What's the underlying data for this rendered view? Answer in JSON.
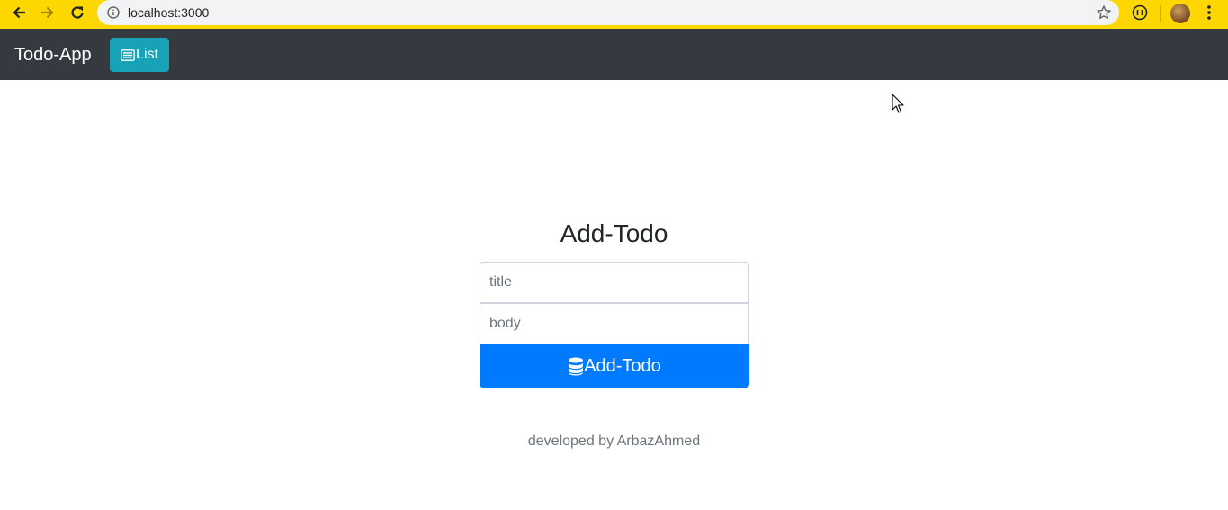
{
  "browser": {
    "url": "localhost:3000"
  },
  "navbar": {
    "brand": "Todo-App",
    "list_button_label": "List",
    "list_button_color": "#17a2b8",
    "background": "#343a40"
  },
  "form": {
    "heading": "Add-Todo",
    "title_placeholder": "title",
    "body_placeholder": "body",
    "submit_label": "Add-Todo",
    "submit_color": "#007bff",
    "submit_icon": "database-icon"
  },
  "footer": {
    "text": "developed by ArbazAhmed"
  },
  "icons": {
    "back": "arrow-left-icon",
    "forward": "arrow-right-icon",
    "reload": "reload-icon",
    "info": "info-icon",
    "bookmark": "star-icon",
    "extension": "extension-icon",
    "menu": "kebab-menu-icon",
    "list": "list-icon"
  }
}
